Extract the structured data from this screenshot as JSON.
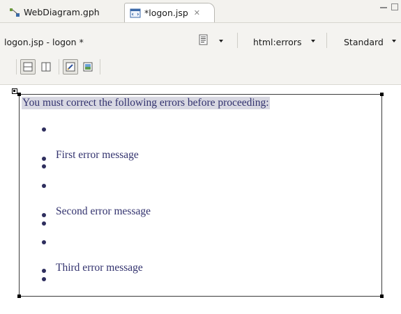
{
  "tabs": [
    {
      "label": "WebDiagram.gph",
      "active": false
    },
    {
      "label": "*logon.jsp",
      "active": true
    }
  ],
  "toolbar": {
    "doc_title": "logon.jsp - logon *",
    "tag_select": "html:errors",
    "mode_select": "Standard"
  },
  "design": {
    "heading": "You must correct the following errors before proceeding:",
    "messages": [
      "First error message",
      "Second error message",
      "Third error message"
    ]
  },
  "colors": {
    "text_blue": "#32326e",
    "heading_highlight": "#d8d8e2",
    "toolbar_bg": "#f4f3f0"
  }
}
